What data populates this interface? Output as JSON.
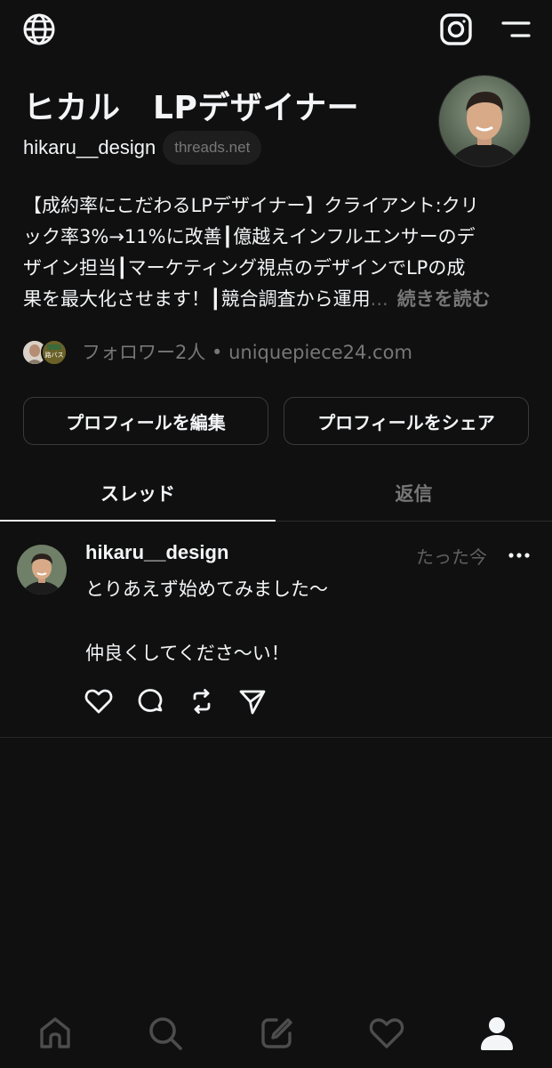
{
  "header": {
    "globe_icon": "globe-icon",
    "instagram_icon": "instagram-icon",
    "menu_icon": "menu-icon"
  },
  "profile": {
    "display_name": "ヒカル　LPデザイナー",
    "username": "hikaru__design",
    "domain_badge": "threads.net",
    "bio_lines": [
      "【成約率にこだわるLPデザイナー】クライアント:クリ",
      "ック率3%→11%に改善┃億越えインフルエンサーのデ",
      "ザイン担当┃マーケティング視点のデザインでLPの成",
      "果を最大化させます！┃競合調査から運用"
    ],
    "bio_ellipsis": "...",
    "bio_more": "続きを読む",
    "followers_text": "フォロワー2人 • uniquepiece24.com",
    "follower_badge_text": "路バス"
  },
  "buttons": {
    "edit": "プロフィールを編集",
    "share": "プロフィールをシェア"
  },
  "tabs": {
    "threads": "スレッド",
    "replies": "返信"
  },
  "post": {
    "username": "hikaru__design",
    "time": "たった今",
    "line1": "とりあえず始めてみました〜",
    "line2": "仲良くしてくださ〜い！"
  },
  "colors": {
    "background": "#101010",
    "text_primary": "#f3f5f7",
    "text_secondary": "#777777",
    "border": "#3a3a3a"
  },
  "bottom_nav": [
    "home-icon",
    "search-icon",
    "compose-icon",
    "heart-icon",
    "profile-icon"
  ]
}
